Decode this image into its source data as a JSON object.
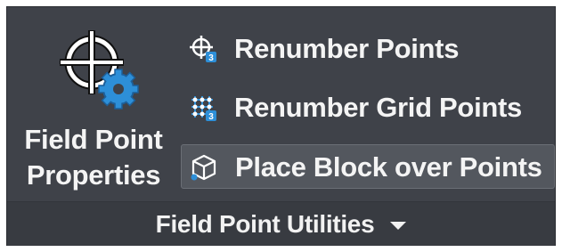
{
  "ribbon_panel": {
    "big_button": {
      "line1": "Field Point",
      "line2": "Properties",
      "icon": "crosshair-gear-icon"
    },
    "small_buttons": [
      {
        "label": "Renumber Points",
        "icon": "crosshair-renumber-icon"
      },
      {
        "label": "Renumber Grid Points",
        "icon": "grid-points-renumber-icon"
      },
      {
        "label": "Place Block over Points",
        "icon": "block-cube-icon",
        "highlighted": true
      }
    ],
    "footer": {
      "title": "Field Point Utilities",
      "icon": "chevron-down-icon"
    }
  },
  "colors": {
    "panel_bg": "#3f4249",
    "footer_bg": "#383b41",
    "hover_bg": "#53575e",
    "accent_blue": "#2d8fd8",
    "text": "#f4f4f4"
  }
}
